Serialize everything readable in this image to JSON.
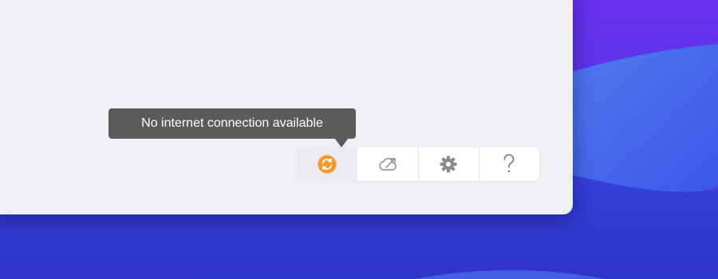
{
  "tooltip": {
    "text": "No internet connection available"
  },
  "toolbar": {
    "buttons": [
      {
        "name": "sync-button",
        "icon": "sync-icon",
        "state": "active",
        "accent": "#f39a2b"
      },
      {
        "name": "cloud-upload-button",
        "icon": "cloud-arrow-icon"
      },
      {
        "name": "settings-button",
        "icon": "gear-icon"
      },
      {
        "name": "help-button",
        "icon": "question-mark-icon",
        "label": "?"
      }
    ]
  },
  "colors": {
    "window_bg": "#f0eff4",
    "tooltip_bg": "#5b5b5d",
    "icon_gray": "#8a8a8e",
    "sync_accent": "#f39a2b",
    "desktop_blue": "#2f37cf",
    "desktop_purple": "#7a2ff0"
  }
}
